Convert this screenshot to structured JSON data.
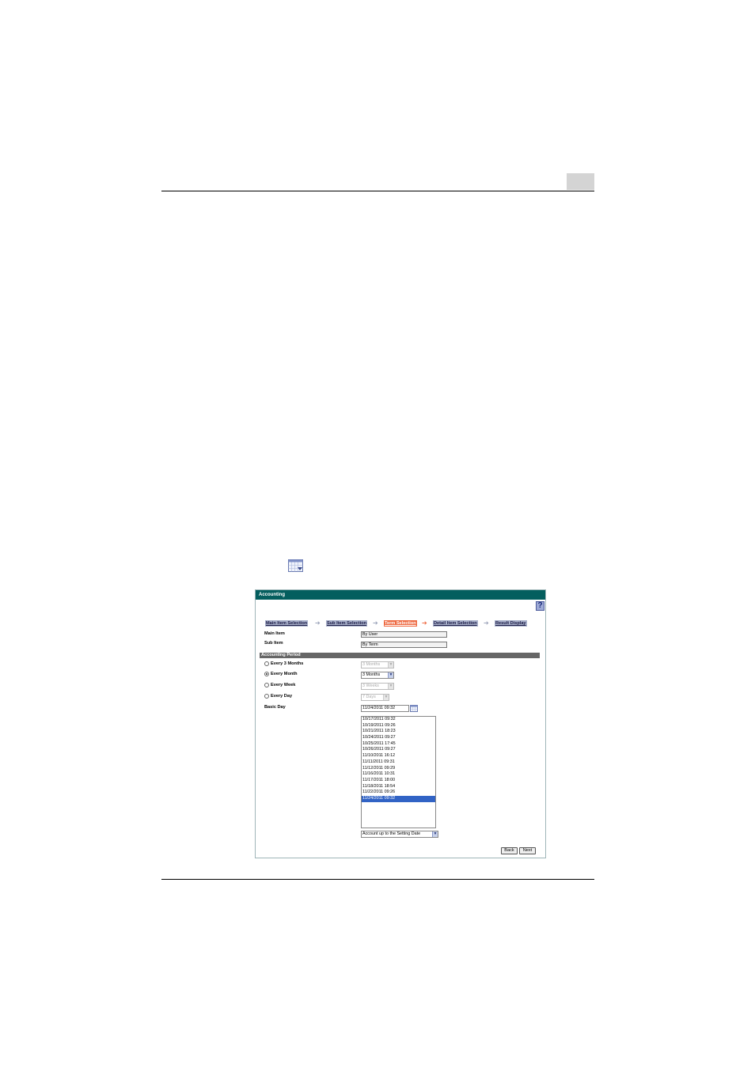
{
  "window": {
    "title": "Accounting",
    "help_label": "?"
  },
  "steps": [
    {
      "label": "Main Item Selection",
      "active": false
    },
    {
      "label": "Sub Item Selection",
      "active": false
    },
    {
      "label": "Term Selection",
      "active": true
    },
    {
      "label": "Detail Item Selection",
      "active": false
    },
    {
      "label": "Result Display",
      "active": false
    }
  ],
  "main_item": {
    "label": "Main Item",
    "value": "By User"
  },
  "sub_item": {
    "label": "Sub Item",
    "value": "By Term"
  },
  "section": {
    "title": "Accounting Period"
  },
  "periods": [
    {
      "label": "Every 3 Months",
      "selected": false,
      "select_value": "3 Months",
      "enabled": false
    },
    {
      "label": "Every Month",
      "selected": true,
      "select_value": "3 Months",
      "enabled": true
    },
    {
      "label": "Every Week",
      "selected": false,
      "select_value": "3 Weeks",
      "enabled": false
    },
    {
      "label": "Every Day",
      "selected": false,
      "select_value": "7 Days",
      "enabled": false
    }
  ],
  "basic_day": {
    "label": "Basic Day",
    "value": "11/24/2011 09:32"
  },
  "dates": [
    "10/17/2011 09:32",
    "10/19/2011 09:26",
    "10/21/2011 18:23",
    "10/24/2011 09:27",
    "10/25/2011 17:45",
    "10/26/2011 09:27",
    "11/10/2011 16:12",
    "11/11/2011 09:31",
    "11/12/2011 09:29",
    "11/16/2011 10:31",
    "11/17/2011 18:00",
    "11/18/2011 18:54",
    "11/22/2011 09:26",
    "11/24/2011 09:32"
  ],
  "selected_date": "11/24/2011 09:32",
  "account_mode": {
    "value": "Account up to the Setting Date"
  },
  "buttons": {
    "back": "Back",
    "next": "Next"
  },
  "colors": {
    "titlebar": "#045e5e",
    "active_step": "#ee6a42",
    "inactive_step": "#aab2cc",
    "selection": "#3163c5",
    "section_bar": "#666666"
  }
}
